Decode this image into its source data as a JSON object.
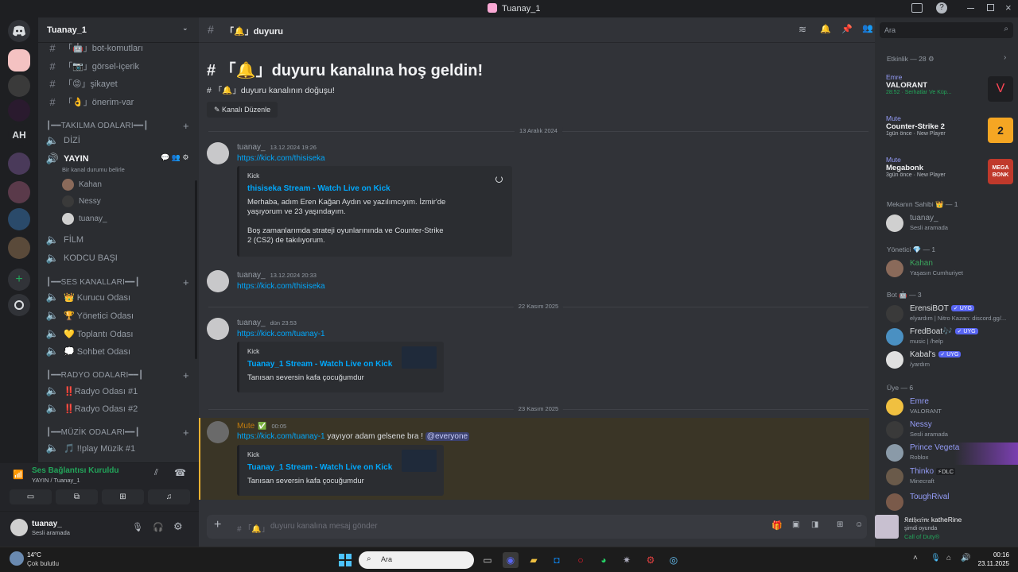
{
  "window": {
    "title": "Tuanay_1",
    "controls": [
      "inbox-icon",
      "help-icon",
      "minimize-icon",
      "maximize-icon",
      "close-icon"
    ]
  },
  "server": {
    "name": "Tuanay_1"
  },
  "guild_icons": [
    {
      "label": ""
    },
    {
      "label": ""
    },
    {
      "label": ""
    },
    {
      "label": ""
    },
    {
      "label": "AH"
    },
    {
      "label": ""
    },
    {
      "label": ""
    },
    {
      "label": ""
    },
    {
      "label": ""
    },
    {
      "label": "+"
    },
    {
      "label": ""
    }
  ],
  "channels": {
    "text": [
      {
        "name": "「🤖」bot-komutları"
      },
      {
        "name": "「📷」görsel-içerik"
      },
      {
        "name": "「😡」şikayet"
      },
      {
        "name": "「👌」önerim-var"
      }
    ],
    "cat_takilma": "┃━━TAKILMA ODALARI━━┃",
    "takilma": [
      {
        "name": "DİZİ"
      },
      {
        "name": "YAYIN",
        "status": "Bir kanal durumu belirle"
      },
      {
        "name": "FİLM"
      },
      {
        "name": "KODCU BAŞI"
      }
    ],
    "yayin_users": [
      "Kahan",
      "Nessy",
      "tuanay_"
    ],
    "cat_ses": "┃━━SES KANALLARI━━┃",
    "ses": [
      {
        "name": "👑 Kurucu Odası"
      },
      {
        "name": "🏆 Yönetici Odası"
      },
      {
        "name": "💛 Toplantı Odası"
      },
      {
        "name": "💭 Sohbet Odası"
      }
    ],
    "cat_radyo": "┃━━RADYO ODALARI━━┃",
    "radyo": [
      {
        "name": "‼️Radyo Odası #1"
      },
      {
        "name": "‼️Radyo Odası #2"
      }
    ],
    "cat_muzik": "┃━━MÜZİK ODALARI━━┃",
    "muzik": [
      {
        "name": "🎵 !!play Müzik #1"
      }
    ]
  },
  "voice_panel": {
    "status": "Ses Bağlantısı Kuruldu",
    "channel": "YAYIN / Tuanay_1",
    "user": "tuanay_",
    "user_status": "Sesli aramada"
  },
  "header": {
    "channel": "「🔔」duyuru",
    "search_placeholder": "Ara"
  },
  "welcome": {
    "title": "# 「🔔」duyuru kanalına hoş geldin!",
    "subtitle": "# 「🔔」duyuru kanalının doğuşu!",
    "edit": "Kanalı Düzenle"
  },
  "dividers": [
    "13 Aralık 2024",
    "22 Kasım 2025",
    "23 Kasım 2025"
  ],
  "messages": [
    {
      "author": "tuanay_",
      "time": "13.12.2024 19:26",
      "link": "https://kick.com/thisiseka",
      "embed": {
        "provider": "Kick",
        "title": "thisiseka Stream - Watch Live on Kick",
        "desc1": "Merhaba, adım Eren Kağan Aydın ve yazılımcıyım. İzmir'de yaşıyorum ve 23 yaşındayım.",
        "desc2": "Boş zamanlarımda strateji oyunlarınında ve Counter-Strike 2 (CS2) de takılıyorum."
      }
    },
    {
      "author": "tuanay_",
      "time": "13.12.2024 20:33",
      "link": "https://kick.com/thisiseka"
    },
    {
      "author": "tuanay_",
      "time": "dün 23:53",
      "link": "https://kick.com/tuanay-1",
      "embed": {
        "provider": "Kick",
        "title": "Tuanay_1 Stream - Watch Live on Kick",
        "desc1": "Tanısan seversin kafa çocuğumdur"
      }
    },
    {
      "author": "Mute",
      "time": "00:05",
      "link": "https://kick.com/tuanay-1",
      "text": " yayıyor adam gelsene bra ! ",
      "mention": "@everyone",
      "embed": {
        "provider": "Kick",
        "title": "Tuanay_1 Stream - Watch Live on Kick",
        "desc1": "Tanısan seversin kafa çocuğumdur"
      }
    }
  ],
  "composer": {
    "placeholder": "duyuru kanalına mesaj gönder",
    "prefix": "# 「🔔」"
  },
  "members": {
    "activity_header": "Etkinlik — 28",
    "activities": [
      {
        "user": "Emre",
        "game": "VALORANT",
        "detail": "28:52 · Serhatlar Ve Küp...",
        "color": "#ff4655"
      },
      {
        "user": "Mute",
        "game": "Counter-Strike 2",
        "detail": "1gün önce · New Player",
        "color": "#f5a623"
      },
      {
        "user": "Mute",
        "game": "Megabonk",
        "detail": "3gün önce · New Player",
        "color": "#c0392b"
      }
    ],
    "owner_header": "Mekanın Sahibi 👑 — 1",
    "owner": [
      {
        "name": "tuanay_",
        "status": "Sesli aramada"
      }
    ],
    "admin_header": "Yönetici 💎 — 1",
    "admin": [
      {
        "name": "Kahan",
        "status": "Yaşasın Cumhuriyet"
      }
    ],
    "bot_header": "Bot 🤖 — 3",
    "bots": [
      {
        "name": "ErensiBOT",
        "status": "elyardım | Nitro Kazan: discord.gg/...",
        "badge": "✓ UYG"
      },
      {
        "name": "FredBoat🎶",
        "status": "music | /help",
        "badge": "✓ UYG"
      },
      {
        "name": "Kabal's",
        "status": "/yardım",
        "badge": "✓ UYG"
      }
    ],
    "member_header": "Üye — 6",
    "users": [
      {
        "name": "Emre",
        "status": "VALORANT",
        "color": "#949cf7"
      },
      {
        "name": "Nessy",
        "status": "Sesli aramada",
        "color": "#949cf7"
      },
      {
        "name": "Prince Vegeta",
        "status": "Roblox",
        "color": "#949cf7"
      },
      {
        "name": "Thinko",
        "status": "Minecraft",
        "color": "#949cf7",
        "tag": "⚡DLC"
      },
      {
        "name": "ToughRival",
        "status": "",
        "color": "#949cf7"
      }
    ],
    "now_playing": {
      "name": "𝔎𝔞𝔱𝔥𝔢𝔯𝔦𝔫𝔢 katheRine",
      "status": "şimdi oyunda",
      "game": "Call of Duty®"
    }
  },
  "taskbar": {
    "weather_temp": "14°C",
    "weather_desc": "Çok bulutlu",
    "search": "Ara",
    "time": "00:16",
    "date": "23.11.2025"
  }
}
